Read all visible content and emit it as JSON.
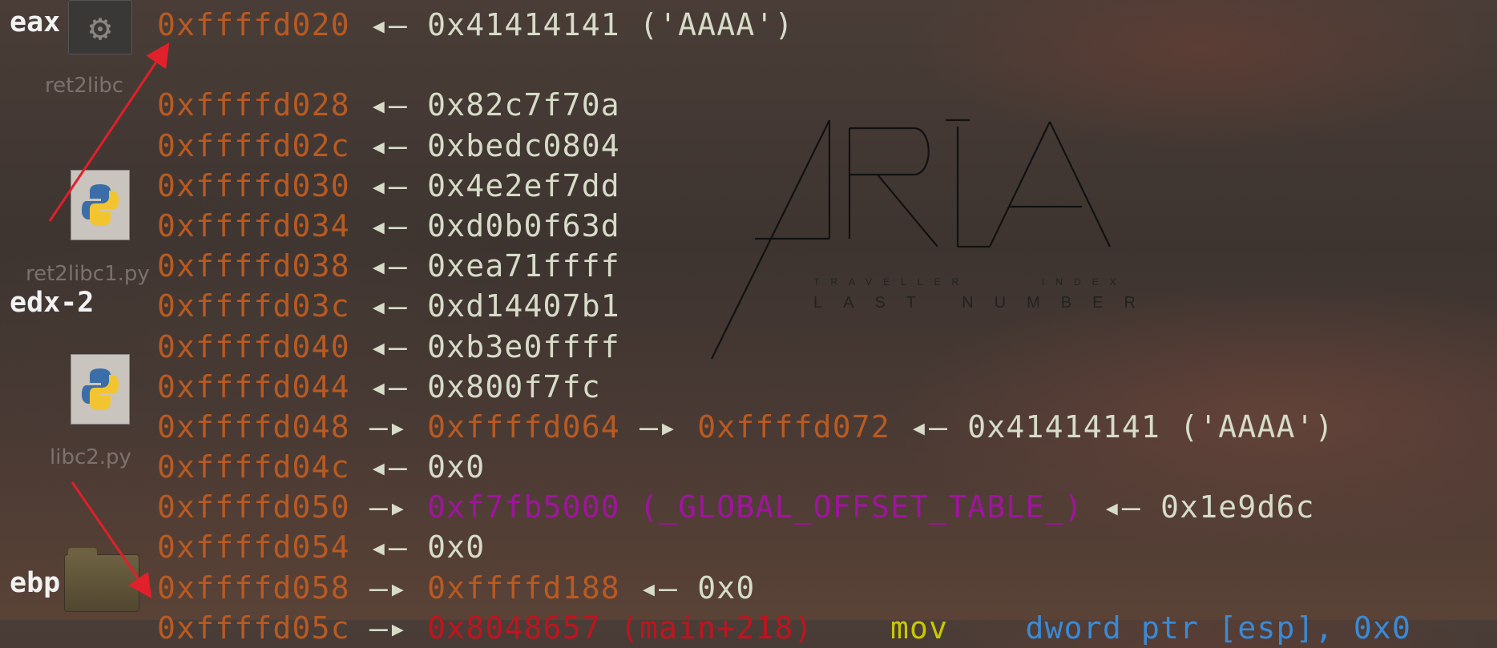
{
  "desktop": {
    "icons": [
      {
        "label": "ret2libc",
        "icon": "gear-icon"
      },
      {
        "label": "ret2libc1.py",
        "icon": "python-file-icon"
      },
      {
        "label": "libc2.py",
        "icon": "python-file-icon"
      },
      {
        "label": "",
        "icon": "folder-icon"
      }
    ]
  },
  "wallpaper": {
    "logo_text": "ARIA",
    "subtitle_left": "TRAVELLER",
    "subtitle_right": "INDEX",
    "tagline": "LAST NUMBER"
  },
  "registers": {
    "eax": "eax",
    "edx": "edx-2",
    "ebp": "ebp"
  },
  "stack": [
    {
      "addr": "0xffffd020",
      "arrow": " ◂— ",
      "value": "0x41414141 ('AAAA')"
    },
    {
      "addr": "",
      "arrow": "",
      "value": ""
    },
    {
      "addr": "0xffffd028",
      "arrow": " ◂— ",
      "value": "0x82c7f70a"
    },
    {
      "addr": "0xffffd02c",
      "arrow": " ◂— ",
      "value": "0xbedc0804"
    },
    {
      "addr": "0xffffd030",
      "arrow": " ◂— ",
      "value": "0x4e2ef7dd"
    },
    {
      "addr": "0xffffd034",
      "arrow": " ◂— ",
      "value": "0xd0b0f63d"
    },
    {
      "addr": "0xffffd038",
      "arrow": " ◂— ",
      "value": "0xea71ffff"
    },
    {
      "addr": "0xffffd03c",
      "arrow": " ◂— ",
      "value": "0xd14407b1"
    },
    {
      "addr": "0xffffd040",
      "arrow": " ◂— ",
      "value": "0xb3e0ffff"
    },
    {
      "addr": "0xffffd044",
      "arrow": " ◂— ",
      "value": "0x800f7fc"
    },
    {
      "addr": "0xffffd048",
      "arrow": " —▸ ",
      "ptr1": "0xffffd064",
      "arrow2": " —▸ ",
      "ptr2": "0xffffd072",
      "arrow3": " ◂— ",
      "value": "0x41414141 ('AAAA')"
    },
    {
      "addr": "0xffffd04c",
      "arrow": " ◂— ",
      "value": "0x0"
    },
    {
      "addr": "0xffffd050",
      "arrow": " —▸ ",
      "got": "0xf7fb5000 (_GLOBAL_OFFSET_TABLE_)",
      "arrow3": " ◂— ",
      "value": "0x1e9d6c"
    },
    {
      "addr": "0xffffd054",
      "arrow": " ◂— ",
      "value": "0x0"
    },
    {
      "addr": "0xffffd058",
      "arrow": " —▸ ",
      "ptr1": "0xffffd188",
      "arrow3": " ◂— ",
      "value": "0x0"
    },
    {
      "addr": "0xffffd05c",
      "arrow": " —▸ ",
      "code": "0x8048657 (main+218)",
      "mnemonic": "mov",
      "operand": "dword ptr [esp], 0x0"
    }
  ],
  "colors": {
    "address": "#b85a22",
    "value": "#d6dcc8",
    "got": "#a0149e",
    "code": "#c0141e",
    "annotation_arrow": "#e0202a"
  }
}
